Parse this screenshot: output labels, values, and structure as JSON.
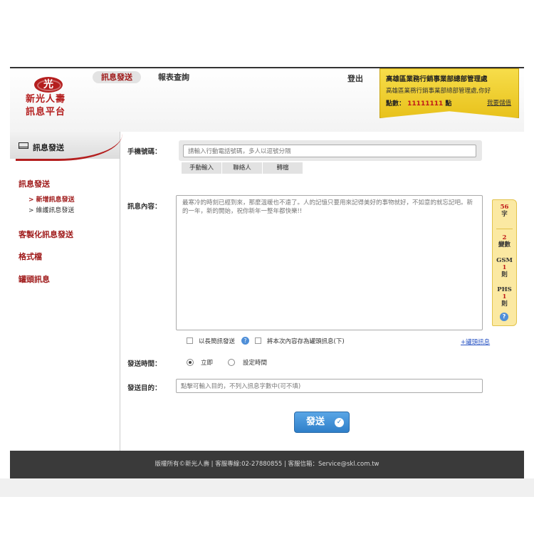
{
  "header": {
    "logo_line1": "新光人壽",
    "logo_line2": "訊息平台",
    "logo_mark": "光",
    "nav_tabs": [
      {
        "label": "訊息發送",
        "active": true
      },
      {
        "label": "報表查詢",
        "active": false
      }
    ],
    "logout_label": "登出",
    "ribbon": {
      "dept_name": "高雄區業務行銷事業部總部管理處",
      "welcome": "高雄區業務行銷事業部總部管理處,你好",
      "points_label": "點數：",
      "points_value": "11111111",
      "points_unit": "點",
      "topup_link": "我要儲值"
    }
  },
  "sidebar": {
    "header_title": "訊息發送",
    "items": [
      {
        "label": "訊息發送"
      },
      {
        "label": "客製化訊息發送"
      },
      {
        "label": "格式檔"
      },
      {
        "label": "罐頭訊息"
      }
    ],
    "sub_items": [
      {
        "label": "> 新增訊息發送",
        "active": true
      },
      {
        "label": "> 維護訊息發送",
        "active": false
      }
    ]
  },
  "form": {
    "phone_label": "手機號碼：",
    "phone_placeholder": "請輸入行動電話號碼，多人以逗號分隔",
    "input_tabs": [
      "手動輸入",
      "聯絡人",
      "轉檔"
    ],
    "content_label": "訊息內容：",
    "content_text": "最寒冷的時刻已經到來，那麼溫暖也不遠了。人的記憶只要用來記得美好的事物就好，不如意的就忘記吧。新的一年，新的開始，祝你新年一整年都快樂!!",
    "counter": {
      "chars": "56",
      "chars_unit": "字",
      "vars": "2",
      "vars_unit": "變數",
      "gsm_label": "GSM",
      "gsm_value": "1",
      "gsm_unit": "則",
      "phs_label": "PHS",
      "phs_value": "1",
      "phs_unit": "則",
      "help": "?"
    },
    "long_sms_label": "以長簡訊發送",
    "save_canned_label": "將本次內容存為罐頭訊息(下)",
    "canned_link": "+罐頭訊息",
    "send_time_label": "發送時間：",
    "send_now_label": "立即",
    "send_schedule_label": "設定時間",
    "send_now_selected": true,
    "purpose_label": "發送目的：",
    "purpose_placeholder": "點擊可輸入目的，不列入訊息字數中(可不填)",
    "send_button": "發送"
  },
  "footer": {
    "text": "版權所有©新光人壽 | 客服專線:02-27880855 | 客服信箱：Service@skl.com.tw"
  },
  "colors": {
    "brand_red": "#b41e1e",
    "ribbon_gold": "#f0cf2f",
    "send_blue": "#2f7fc9",
    "footer_bg": "#3a3a3a"
  }
}
